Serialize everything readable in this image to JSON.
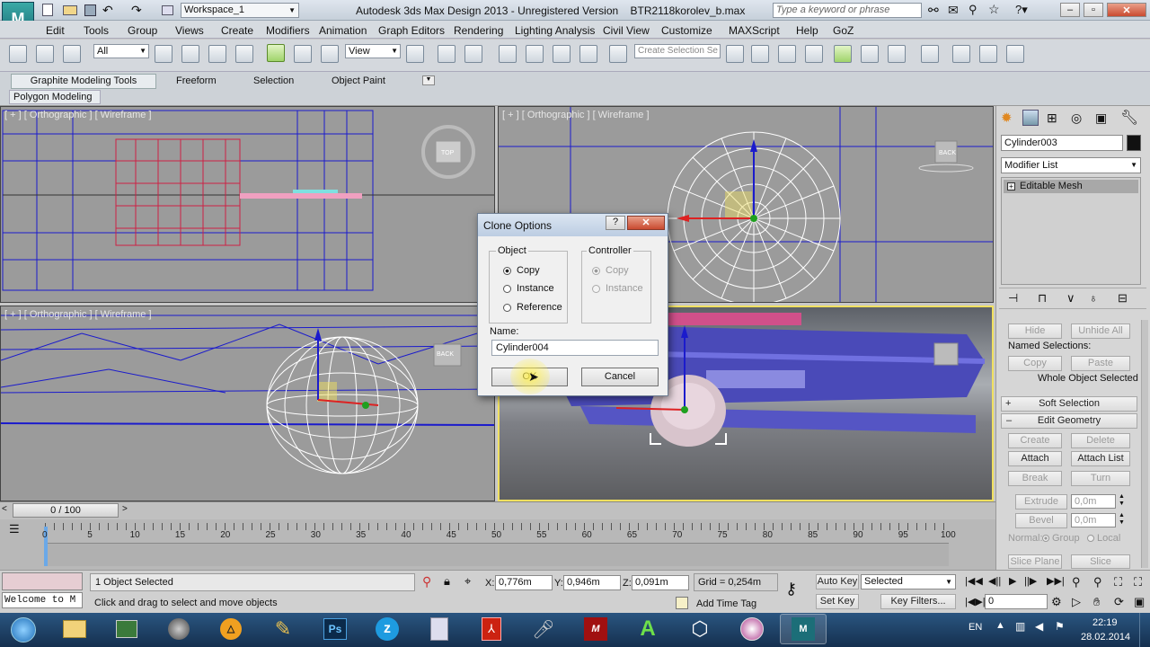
{
  "titlebar": {
    "workspace": "Workspace_1",
    "title": "Autodesk 3ds Max Design 2013 - Unregistered Version    BTR2118korolev_b.max",
    "search_placeholder": "Type a keyword or phrase"
  },
  "menu": [
    "Edit",
    "Tools",
    "Group",
    "Views",
    "Create",
    "Modifiers",
    "Animation",
    "Graph Editors",
    "Rendering",
    "Lighting Analysis",
    "Civil View",
    "Customize",
    "MAXScript",
    "Help",
    "GoZ"
  ],
  "toolbar": {
    "filter_value": "All",
    "view_value": "View",
    "named_selection_placeholder": "Create Selection Se"
  },
  "ribbon": {
    "tabs": [
      "Graphite Modeling Tools",
      "Freeform",
      "Selection",
      "Object Paint"
    ],
    "subtab": "Polygon Modeling"
  },
  "viewports": {
    "top_left": "[ + ] [ Orthographic ] [ Wireframe ]",
    "top_right": "[ + ] [ Orthographic ] [ Wireframe ]",
    "bottom_left": "[ + ] [ Orthographic ] [ Wireframe ]",
    "cube_top": "TOP",
    "cube_back": "BACK",
    "cube_left": "BACK"
  },
  "dialog": {
    "title": "Clone Options",
    "object_group": "Object",
    "controller_group": "Controller",
    "options": [
      "Copy",
      "Instance",
      "Reference"
    ],
    "controller_options": [
      "Copy",
      "Instance"
    ],
    "name_label": "Name:",
    "name_value": "Cylinder004",
    "ok": "OK",
    "cancel": "Cancel"
  },
  "command_panel": {
    "object_name": "Cylinder003",
    "modifier_list": "Modifier List",
    "stack_item": "Editable Mesh",
    "hide": "Hide",
    "unhide_all": "Unhide All",
    "named_selections": "Named Selections:",
    "copy": "Copy",
    "paste": "Paste",
    "whole_object": "Whole Object Selected",
    "soft_selection": "Soft Selection",
    "edit_geometry": "Edit Geometry",
    "create": "Create",
    "delete": "Delete",
    "attach": "Attach",
    "attach_list": "Attach List",
    "break": "Break",
    "turn": "Turn",
    "extrude": "Extrude",
    "extrude_val": "0,0m",
    "bevel": "Bevel",
    "bevel_val": "0,0m",
    "normal": "Normal:",
    "group": "Group",
    "local": "Local",
    "slice_plane": "Slice Plane",
    "slice": "Slice"
  },
  "timeline": {
    "frame": "0 / 100",
    "ticks": [
      "0",
      "5",
      "10",
      "15",
      "20",
      "25",
      "30",
      "35",
      "40",
      "45",
      "50",
      "55",
      "60",
      "65",
      "70",
      "75",
      "80",
      "85",
      "90",
      "95",
      "100"
    ]
  },
  "status": {
    "selected": "1 Object Selected",
    "prompt": "Click and drag to select and move objects",
    "maxscript": "Welcome to M",
    "x_label": "X:",
    "x": "0,776m",
    "y_label": "Y:",
    "y": "0,946m",
    "z_label": "Z:",
    "z": "0,091m",
    "grid": "Grid = 0,254m",
    "add_time_tag": "Add Time Tag",
    "auto_key": "Auto Key",
    "set_key": "Set Key",
    "key_mode": "Selected",
    "key_filters": "Key Filters...",
    "frame_field": "0"
  },
  "taskbar": {
    "lang": "EN",
    "time": "22:19",
    "date": "28.02.2014"
  },
  "colors": {
    "viewport_bg": "#9b9b9b",
    "wire_blue": "#1b1bcc",
    "accent_yellow": "#f0e060",
    "taskbar": "#1d3e63"
  }
}
